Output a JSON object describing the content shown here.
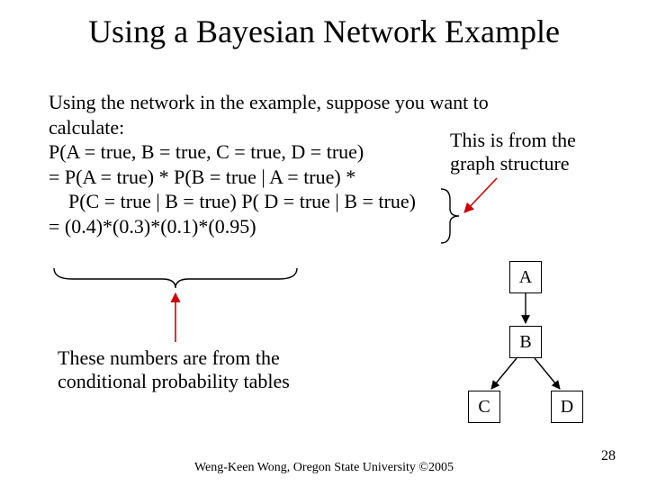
{
  "title": "Using a Bayesian Network Example",
  "body": {
    "l1": "Using the network in the example, suppose you want to",
    "l2": "calculate:",
    "l3": "P(A = true, B = true, C = true, D = true)",
    "l4": "= P(A = true) * P(B = true | A = true) *",
    "l5": "P(C = true | B = true) P( D = true | B = true)",
    "l6": "= (0.4)*(0.3)*(0.1)*(0.95)"
  },
  "annot": {
    "structure_l1": "This is from the",
    "structure_l2": "graph structure",
    "cpt_l1": "These numbers are from the",
    "cpt_l2": "conditional probability tables"
  },
  "nodes": {
    "A": "A",
    "B": "B",
    "C": "C",
    "D": "D"
  },
  "footer": "Weng-Keen Wong, Oregon State University ©2005",
  "page": "28",
  "colors": {
    "accent": "#d00000"
  }
}
